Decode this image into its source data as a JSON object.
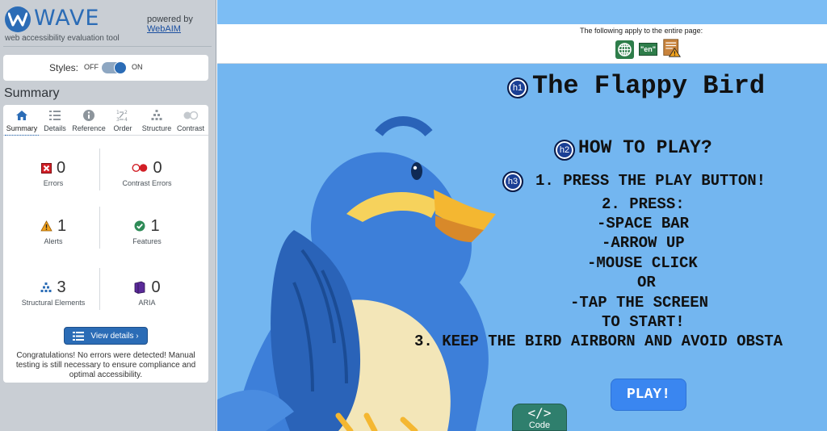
{
  "wave": {
    "logo_text": "WAVE",
    "tagline": "web accessibility evaluation tool",
    "powered_by": "powered by",
    "webaim_link": "WebAIM",
    "styles": {
      "label": "Styles:",
      "off": "OFF",
      "on": "ON",
      "state": "on"
    },
    "summary_heading": "Summary",
    "tabs": [
      {
        "label": "Summary",
        "icon": "home-icon",
        "active": true
      },
      {
        "label": "Details",
        "icon": "list-icon",
        "active": false
      },
      {
        "label": "Reference",
        "icon": "info-icon",
        "active": false
      },
      {
        "label": "Order",
        "icon": "order-icon",
        "active": false
      },
      {
        "label": "Structure",
        "icon": "structure-icon",
        "active": false
      },
      {
        "label": "Contrast",
        "icon": "contrast-icon",
        "active": false
      }
    ],
    "stats": {
      "errors": {
        "count": "0",
        "label": "Errors"
      },
      "contrast_errors": {
        "count": "0",
        "label": "Contrast Errors"
      },
      "alerts": {
        "count": "1",
        "label": "Alerts"
      },
      "features": {
        "count": "1",
        "label": "Features"
      },
      "structural": {
        "count": "3",
        "label": "Structural Elements"
      },
      "aria": {
        "count": "0",
        "label": "ARIA"
      }
    },
    "view_details": "View details ›",
    "congrats": "Congratulations! No errors were detected! Manual testing is still necessary to ensure compliance and optimal accessibility."
  },
  "page": {
    "apply_text": "The following apply to the entire page:",
    "lang_badge": "\"en\"",
    "title": "The Flappy Bird",
    "how_to": "HOW TO PLAY?",
    "instructions": [
      "1. PRESS THE PLAY BUTTON!",
      "2. PRESS:",
      "-SPACE BAR",
      "-ARROW UP",
      "-MOUSE CLICK",
      "OR",
      "-TAP THE SCREEN",
      "TO START!",
      "3. KEEP THE BIRD AIRBORN AND AVOID OBSTA"
    ],
    "play_button": "PLAY!",
    "badges": {
      "h1": "h1",
      "h2": "h2",
      "h3": "h3"
    },
    "code_tab": {
      "glyph": "</>",
      "label": "Code"
    }
  },
  "colors": {
    "wave_blue": "#2b6cb6",
    "sidebar_bg": "#c9ced4",
    "page_bg": "#73b6f0",
    "play_button": "#3a86f0",
    "code_tab": "#2f7f6d",
    "heading_badge": "#1b3f95"
  }
}
